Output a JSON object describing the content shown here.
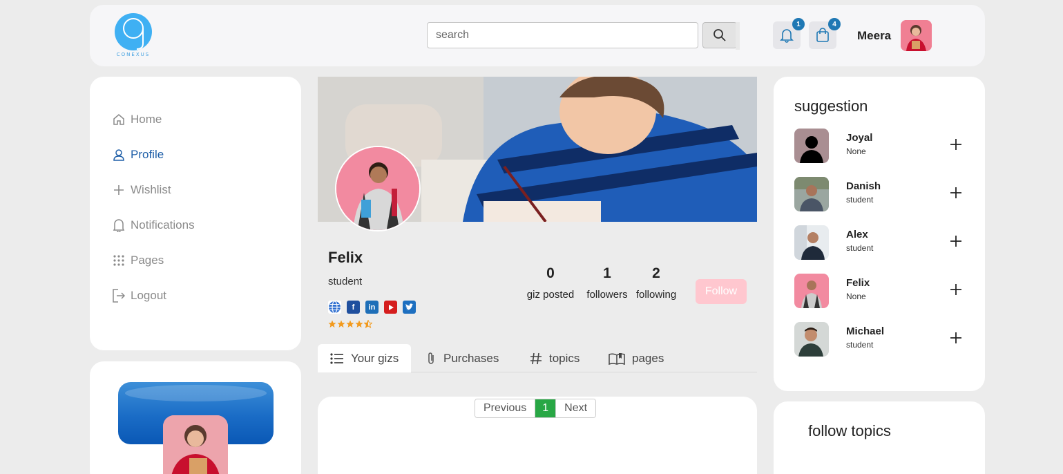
{
  "header": {
    "logo_text": "CONEXUS",
    "search_placeholder": "search",
    "notifications_count": "1",
    "cart_count": "4",
    "user_name": "Meera"
  },
  "sidebar": {
    "items": [
      {
        "label": "Home",
        "icon": "home-icon"
      },
      {
        "label": "Profile",
        "icon": "user-icon",
        "active": true
      },
      {
        "label": "Wishlist",
        "icon": "plus-icon"
      },
      {
        "label": "Notifications",
        "icon": "bell-icon"
      },
      {
        "label": "Pages",
        "icon": "grid-icon"
      },
      {
        "label": "Logout",
        "icon": "logout-icon"
      }
    ]
  },
  "profile": {
    "name": "Felix",
    "role": "student",
    "rating": 4.5,
    "socials": [
      "globe-icon",
      "facebook-icon",
      "linkedin-icon",
      "youtube-icon",
      "twitter-icon"
    ],
    "stats": [
      {
        "value": "0",
        "label": "giz posted"
      },
      {
        "value": "1",
        "label": "followers"
      },
      {
        "value": "2",
        "label": "following"
      }
    ],
    "follow_label": "Follow"
  },
  "tabs": [
    {
      "label": "Your gizs",
      "icon": "list-icon",
      "active": true
    },
    {
      "label": "Purchases",
      "icon": "paperclip-icon"
    },
    {
      "label": "topics",
      "icon": "hash-icon"
    },
    {
      "label": "pages",
      "icon": "book-icon"
    }
  ],
  "pagination": {
    "previous": "Previous",
    "current": "1",
    "next": "Next"
  },
  "suggestions": {
    "title": "suggestion",
    "items": [
      {
        "name": "Joyal",
        "role": "None"
      },
      {
        "name": "Danish",
        "role": "student"
      },
      {
        "name": "Alex",
        "role": "student"
      },
      {
        "name": "Felix",
        "role": "None"
      },
      {
        "name": "Michael",
        "role": "student"
      }
    ]
  },
  "follow_topics": {
    "title": "follow topics"
  },
  "colors": {
    "accent": "#1f5fa8",
    "badge": "#1f78b4",
    "follow": "#ffc7cf",
    "page_current": "#28a745"
  }
}
